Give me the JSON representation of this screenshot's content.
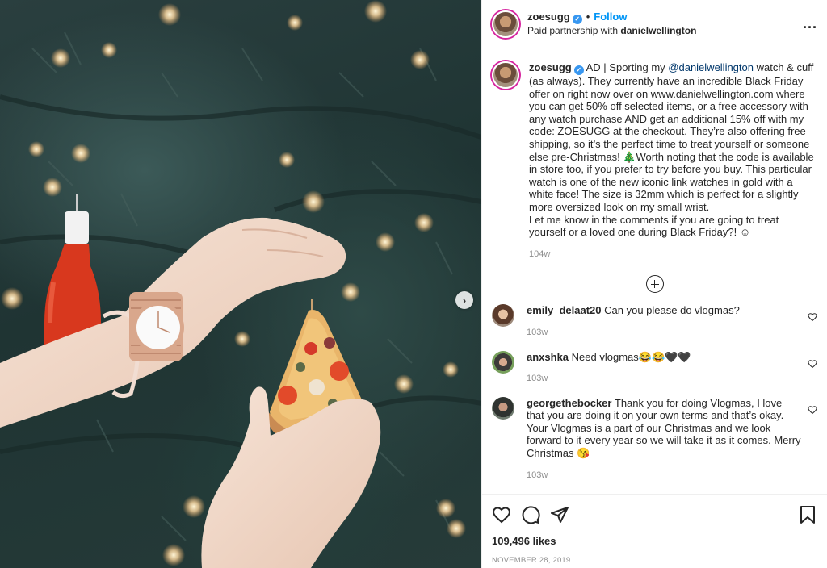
{
  "photo": {
    "alt_next": "›"
  },
  "header": {
    "username": "zoesugg",
    "separator": "•",
    "follow_label": "Follow",
    "partner_prefix": "Paid partnership with ",
    "partner_name": "danielwellington",
    "more_label": "..."
  },
  "caption": {
    "username": "zoesugg",
    "text_1": "AD | Sporting my ",
    "mention": "@danielwellington",
    "text_2": " watch & cuff (as always). They currently have an incredible Black Friday offer on right now over on www.danielwellington.com where you can get 50% off selected items, or a free accessory with any watch purchase AND get an additional 15% off with my code: ZOESUGG at the checkout. They’re also offering free shipping, so it’s the perfect time to treat yourself or someone else pre-Christmas! 🎄Worth noting that the code is available in store too, if you prefer to try before you buy. This particular watch is one of the new iconic link watches in gold with a white face! The size is 32mm which is perfect for a slightly more oversized look on my small wrist.",
    "text_3": "Let me know in the comments if you are going to treat yourself or a loved one during Black Friday?! ☺",
    "time": "104w"
  },
  "comments": [
    {
      "username": "emily_delaat20",
      "text": "Can you please do vlogmas?",
      "time": "103w"
    },
    {
      "username": "anxshka",
      "text": "Need vlogmas😂😂🖤🖤",
      "time": "103w"
    },
    {
      "username": "georgethebocker",
      "text": "Thank you for doing Vlogmas, I love that you are doing it on your own terms and that’s okay. Your Vlogmas is a part of our Christmas and we look forward to it every year so we will take it as it comes. Merry Christmas 😘",
      "time": "103w"
    }
  ],
  "likes": "109,496 likes",
  "date": "NOVEMBER 28, 2019",
  "colors": {
    "accent": "#0095f6",
    "mention": "#00376b",
    "muted": "#8e8e8e"
  }
}
